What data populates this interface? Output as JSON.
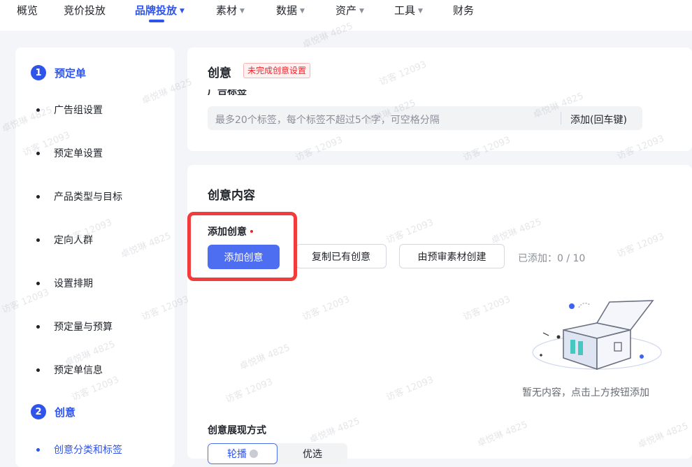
{
  "nav": {
    "items": [
      {
        "label": "概览",
        "caret": false,
        "active": false
      },
      {
        "label": "竞价投放",
        "caret": false,
        "active": false
      },
      {
        "label": "品牌投放",
        "caret": true,
        "active": true
      },
      {
        "label": "素材",
        "caret": true,
        "active": false
      },
      {
        "label": "数据",
        "caret": true,
        "active": false
      },
      {
        "label": "资产",
        "caret": true,
        "active": false
      },
      {
        "label": "工具",
        "caret": true,
        "active": false
      },
      {
        "label": "财务",
        "caret": false,
        "active": false
      }
    ]
  },
  "sidebar": {
    "step1": {
      "num": "1",
      "title": "预定单"
    },
    "step1_items": [
      "广告组设置",
      "预定单设置",
      "产品类型与目标",
      "定向人群",
      "设置排期",
      "预定量与预算",
      "预定单信息"
    ],
    "step2": {
      "num": "2",
      "title": "创意"
    },
    "step2_items": [
      "创意分类和标签"
    ]
  },
  "creative": {
    "title": "创意",
    "status_badge": "未完成创意设置",
    "tag_label": "广告标签",
    "tag_placeholder": "最多20个标签，每个标签不超过5个字，可空格分隔",
    "tag_add": "添加(回车键)"
  },
  "content": {
    "title": "创意内容",
    "add_label": "添加创意",
    "add_button": "添加创意",
    "copy_button": "复制已有创意",
    "precheck_button": "由预审素材创建",
    "added_count": "已添加：0 / 10",
    "empty_text": "暂无内容，点击上方按钮添加",
    "display_label": "创意展现方式",
    "display_options": [
      "轮播",
      "优选"
    ]
  },
  "watermark": {
    "name": "卓悦琳 4825",
    "visitor": "访客 12093"
  },
  "colors": {
    "accent": "#2f54eb",
    "primary_button": "#4e6ef2",
    "highlight": "#f23c3c"
  }
}
